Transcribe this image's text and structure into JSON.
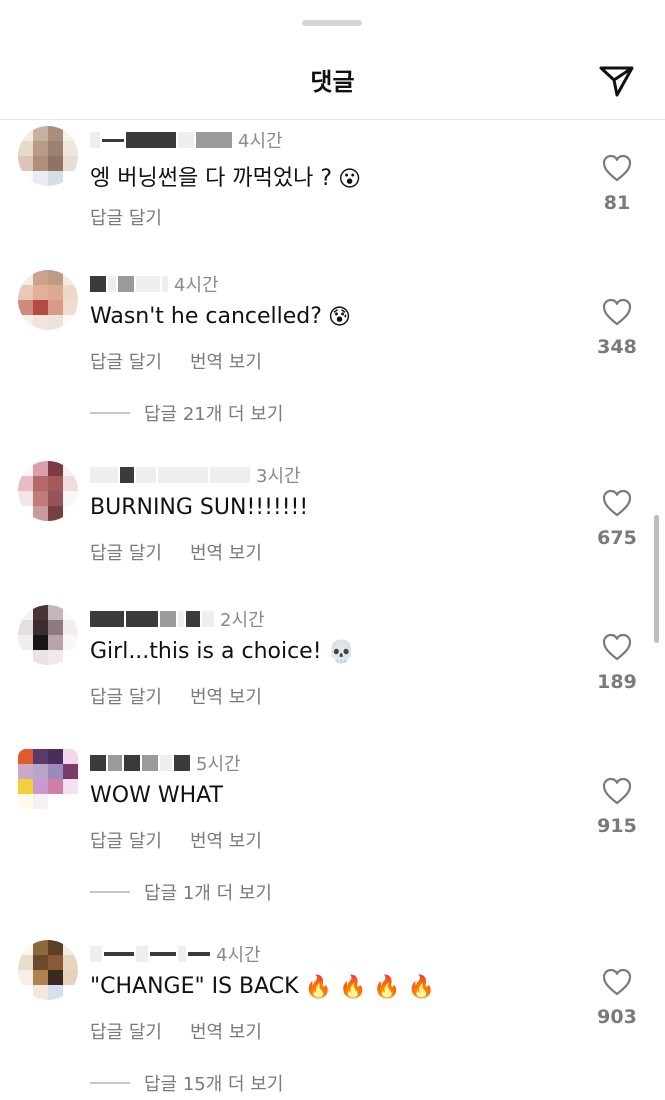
{
  "header": {
    "title": "댓글",
    "send_icon": "send-icon"
  },
  "colors": {
    "text": "#111111",
    "secondary": "#7a7a7a",
    "divider": "#e6e6e6"
  },
  "comments": [
    {
      "time": "4시간",
      "text": "엥 버닝썬을 다 까먹었나 ?",
      "emoji": "😮",
      "reply_label": "답글 달기",
      "translate_label": "",
      "likes": "81",
      "replies": ""
    },
    {
      "time": "4시간",
      "text": "Wasn't he cancelled?",
      "emoji": "😰",
      "reply_label": "답글 달기",
      "translate_label": "번역 보기",
      "likes": "348",
      "replies": "답글 21개 더 보기"
    },
    {
      "time": "3시간",
      "text": "BURNING SUN!!!!!!!",
      "emoji": "",
      "reply_label": "답글 달기",
      "translate_label": "번역 보기",
      "likes": "675",
      "replies": ""
    },
    {
      "time": "2시간",
      "text": "Girl...this is a choice!",
      "emoji": "💀",
      "reply_label": "답글 달기",
      "translate_label": "번역 보기",
      "likes": "189",
      "replies": ""
    },
    {
      "time": "5시간",
      "text": "WOW WHAT",
      "emoji": "",
      "reply_label": "답글 달기",
      "translate_label": "번역 보기",
      "likes": "915",
      "replies": "답글 1개 더 보기"
    },
    {
      "time": "4시간",
      "text": "\"CHANGE\" IS BACK",
      "emoji": "🔥 🔥 🔥 🔥",
      "reply_label": "답글 달기",
      "translate_label": "번역 보기",
      "likes": "903",
      "replies": "답글 15개 더 보기"
    }
  ]
}
